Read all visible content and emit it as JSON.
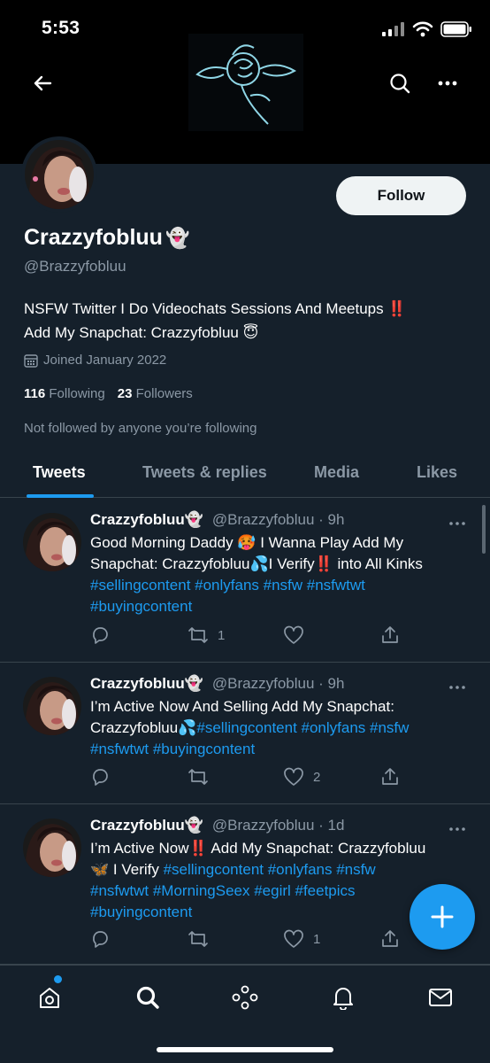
{
  "status_bar": {
    "time": "5:53"
  },
  "profile": {
    "display_name": "Crazzyfobluu",
    "name_emoji": "👻",
    "handle": "@Brazzyfobluu",
    "follow_label": "Follow",
    "bio_line1": "NSFW Twitter I Do Videochats Sessions And Meetups ‼️",
    "bio_line2": "Add My Snapchat: Crazzyfobluu 😇",
    "joined": "Joined January 2022",
    "following_count": "116",
    "following_label": "Following",
    "followers_count": "23",
    "followers_label": "Followers",
    "not_followed": "Not followed by anyone you’re following"
  },
  "tabs": [
    {
      "label": "Tweets"
    },
    {
      "label": "Tweets & replies"
    },
    {
      "label": "Media"
    },
    {
      "label": "Likes"
    }
  ],
  "tweets": [
    {
      "name": "Crazzyfobluu👻",
      "meta": "@Brazzyfobluu · 9h",
      "line1": "Good Morning Daddy 🥵 I Wanna Play Add My",
      "line2": "Snapchat: Crazzyfobluu💦I Verify‼️ into All Kinks",
      "line3": "#sellingcontent #onlyfans #nsfw #nsfwtwt",
      "line4": "#buyingcontent",
      "retweets": "1",
      "likes": ""
    },
    {
      "name": "Crazzyfobluu👻",
      "meta": "@Brazzyfobluu · 9h",
      "line1": "I’m Active Now And Selling Add My Snapchat:",
      "line2a": "Crazzyfobluu💦",
      "line2b": "#sellingcontent #onlyfans #nsfw",
      "line3": "#nsfwtwt #buyingcontent",
      "retweets": "",
      "likes": "2"
    },
    {
      "name": "Crazzyfobluu👻",
      "meta": "@Brazzyfobluu · 1d",
      "line1": "I’m Active Now‼️ Add My Snapchat: Crazzyfobluu",
      "line2a": "🦋 I Verify ",
      "line2b": "#sellingcontent #onlyfans #nsfw",
      "line3": "#nsfwtwt #MorningSeex #egirl #feetpics",
      "line4": "#buyingcontent",
      "retweets": "",
      "likes": "1"
    }
  ],
  "icons": {
    "back": "arrow-left-icon",
    "search": "search-icon",
    "more": "more-icon",
    "calendar": "calendar-icon",
    "reply": "reply-icon",
    "retweet": "retweet-icon",
    "like": "heart-icon",
    "share": "share-icon",
    "compose": "plus-icon",
    "home": "home-icon",
    "explore": "search-icon",
    "spaces": "spaces-icon",
    "notifications": "bell-icon",
    "messages": "mail-icon"
  },
  "colors": {
    "background": "#15202b",
    "accent": "#1d9bf0",
    "secondary_text": "#8b98a5",
    "divider": "#38444d"
  }
}
